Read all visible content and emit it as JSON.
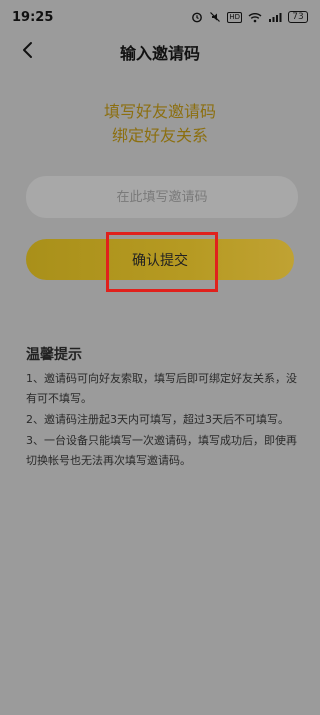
{
  "status_bar": {
    "time": "19:25",
    "icons": [
      "alarm-icon",
      "silent-icon",
      "hd-icon",
      "wifi-icon",
      "signal-icon",
      "battery-icon"
    ],
    "hd_label": "HD",
    "battery_level": "73"
  },
  "nav": {
    "back_icon": "chevron-left-icon",
    "title": "输入邀请码"
  },
  "headline": {
    "line1": "填写好友邀请码",
    "line2": "绑定好友关系"
  },
  "invite_input": {
    "value": "",
    "placeholder": "在此填写邀请码"
  },
  "confirm_button": {
    "label": "确认提交"
  },
  "tips": {
    "title": "温馨提示",
    "items": [
      "1、邀请码可向好友索取，填写后即可绑定好友关系，没有可不填写。",
      "2、邀请码注册起3天内可填写，超过3天后不可填写。",
      "3、一台设备只能填写一次邀请码，填写成功后，即使再切换帐号也无法再次填写邀请码。"
    ]
  },
  "colors": {
    "overlay": "#9b9b9b",
    "accent_text": "#8c6f10",
    "button_gold": "#b69a22",
    "highlight_red": "#e0211c"
  }
}
